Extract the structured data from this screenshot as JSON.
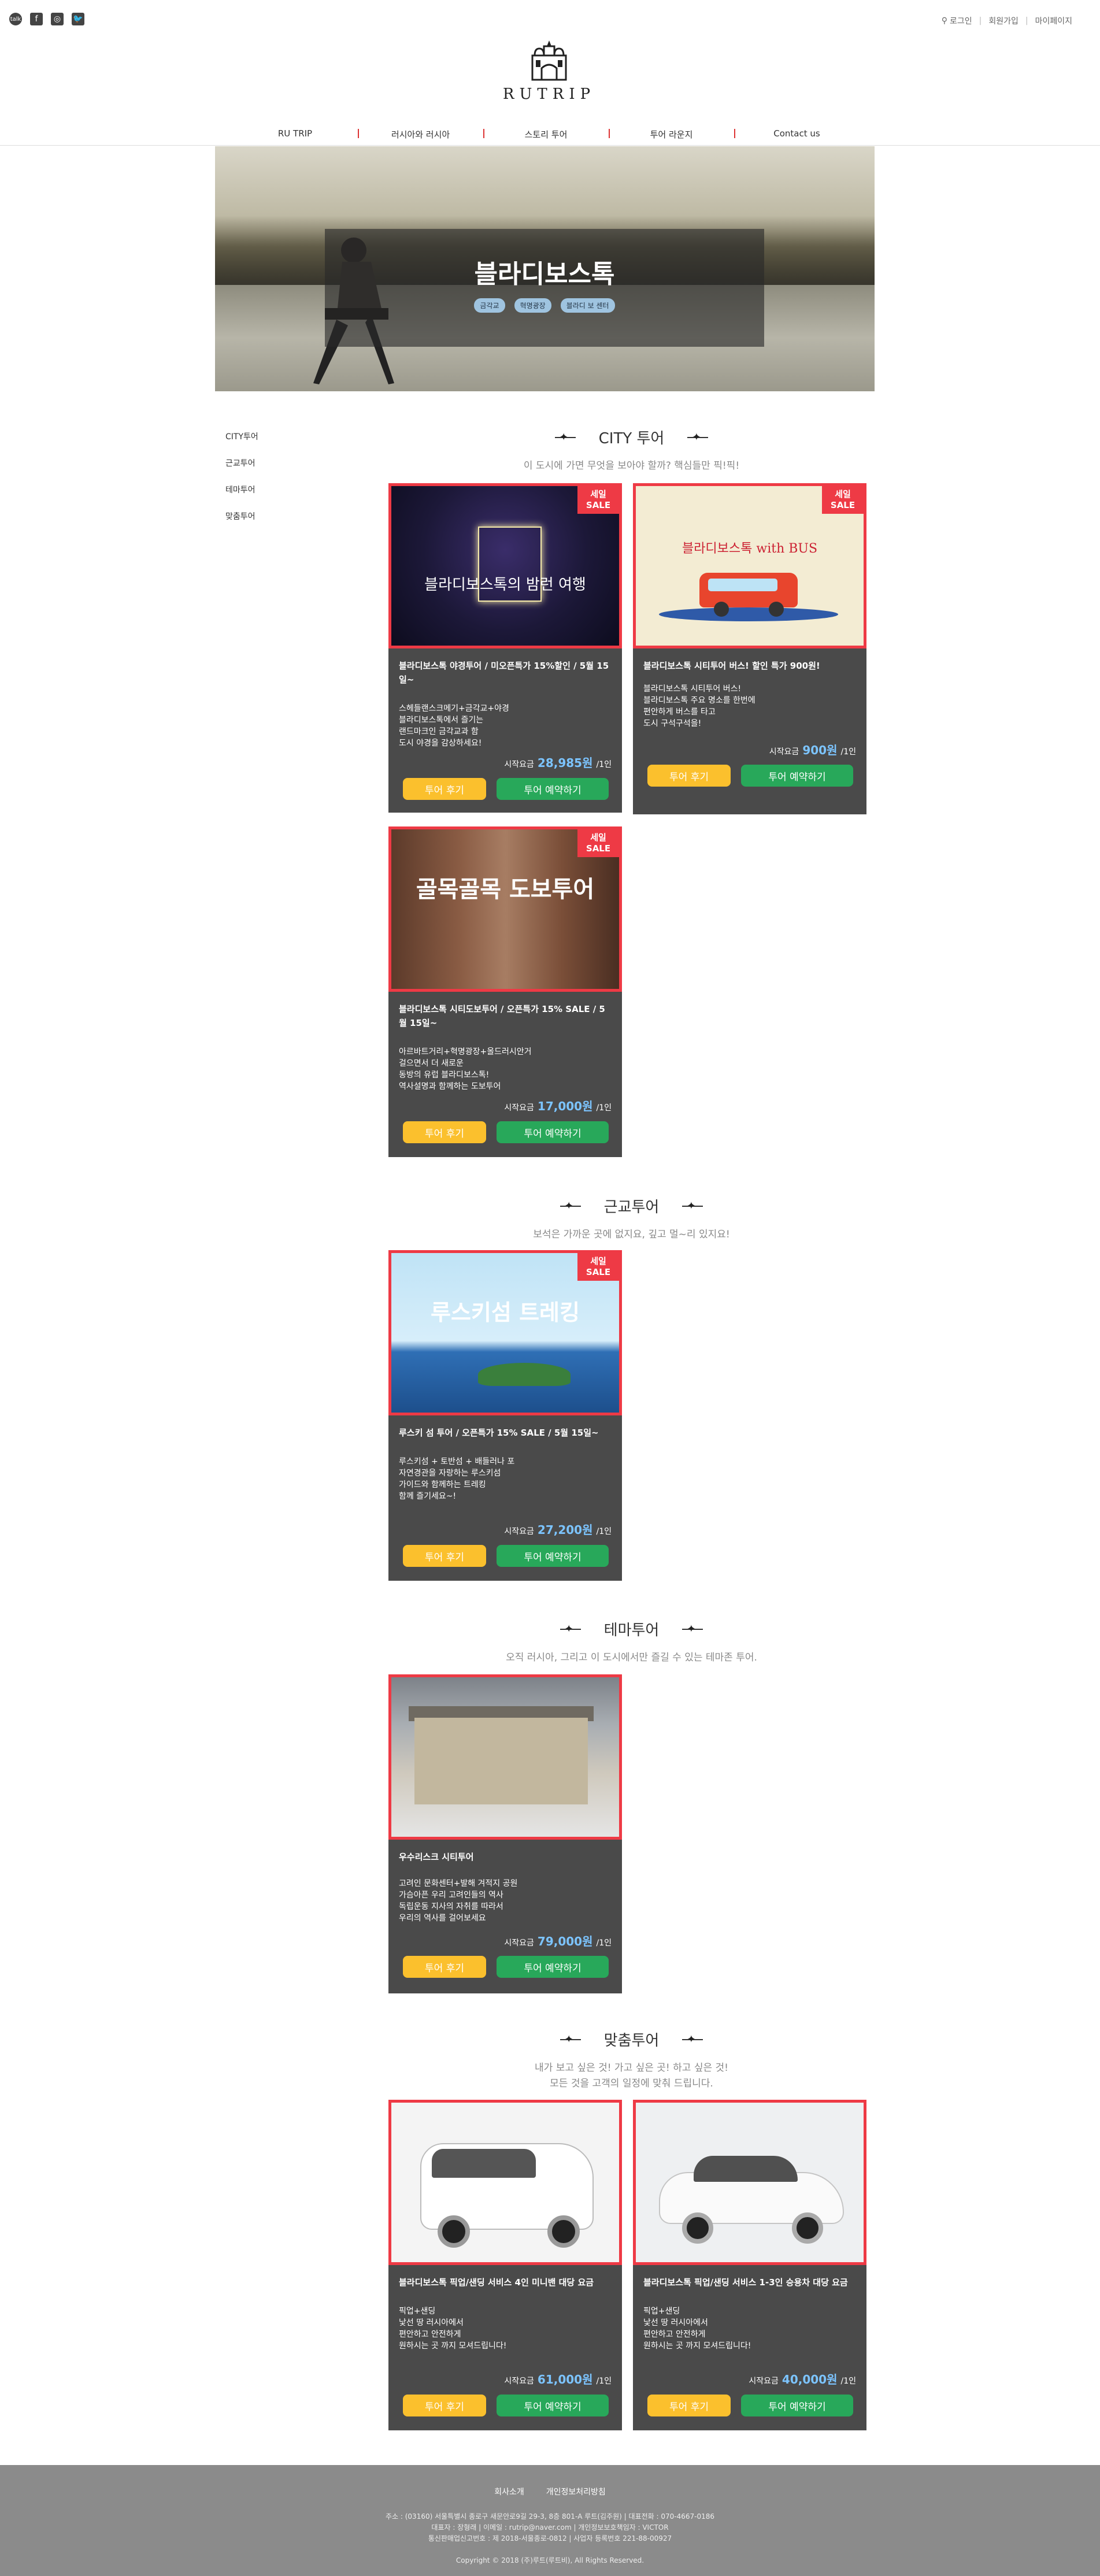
{
  "social": {
    "kakao": "talk",
    "facebook": "f",
    "instagram": "◎",
    "twitter": "🐦"
  },
  "utilnav": {
    "login": "로그인",
    "signup": "회원가입",
    "mypage": "마이페이지"
  },
  "logo": {
    "text": "RUTRIP"
  },
  "mainnav": [
    "RU TRIP",
    "러시아와 러시아",
    "스토리 투어",
    "투어 라운지",
    "Contact us"
  ],
  "hero": {
    "title": "블라디보스톡",
    "tags": [
      "금각교",
      "혁명광장",
      "블라디 보 센터"
    ]
  },
  "sidemenu": [
    "CITY투어",
    "근교투어",
    "테마투어",
    "맞춤투어"
  ],
  "sections": [
    {
      "title": "CITY 투어",
      "subtitle": "이 도시에 가면 무엇을 보아야 할까? 핵심들만 픽!픽!"
    },
    {
      "title": "근교투어",
      "subtitle": "보석은 가까운 곳에 없지요, 깊고 멀~리 있지요!"
    },
    {
      "title": "테마투어",
      "subtitle": "오직 러시아, 그리고 이 도시에서만 즐길 수 있는 테마존 투어."
    },
    {
      "title": "맞춤투어",
      "subtitle": "내가 보고 싶은 것! 가고 싶은 곳! 하고 싶은 것!",
      "subtitle2": "모든 것을 고객의 일정에 맞춰 드립니다."
    }
  ],
  "badge": {
    "line1": "세일",
    "line2": "SALE"
  },
  "price_label": "시작요금",
  "per_person": "/1인",
  "review_label": "투어 후기",
  "book_label": "투어 예약하기",
  "cards": [
    {
      "title": "블라디보스톡 야경투어 / 미오픈특가 15%할인 / 5월 15일~",
      "desc": [
        "스헤들랜스크메기+금각교+야경",
        "블라디보스톡에서 즐기는",
        "랜드마크인 금각교과 함",
        "도시 야경을 감상하세요!"
      ],
      "price": "28,985원",
      "art": "블라디보스톡의 밤런 여행"
    },
    {
      "title": "블라디보스톡 시티투어 버스! 할인 특가 900원!",
      "desc": [
        "블라디보스톡 시티투어 버스!",
        "블라디보스톡 주요 명소를 한번에",
        "편안하게 버스를 타고",
        "도시 구석구석을!"
      ],
      "price": "900원",
      "art": "블라디보스톡 with BUS"
    },
    {
      "title": "블라디보스톡 시티도보투어 / 오픈특가 15% SALE / 5월 15일~",
      "desc": [
        "아르바트거리+혁명광장+올드러시안거",
        "걸으면서 더 새로운",
        "동방의 유럽 블라디보스톡!",
        "역사설명과 함께하는 도보투어"
      ],
      "price": "17,000원",
      "art": "골목골목 도보투어"
    },
    {
      "title": "루스키 섬 투어 / 오픈특가 15% SALE / 5월 15일~",
      "desc": [
        "루스키섬 + 토반섬 + 배들러나 포",
        "자연경관을 자랑하는 루스키섬",
        "가이드와 함께하는 트레킹",
        "함께 즐기세요~!"
      ],
      "price": "27,200원",
      "art": "루스키섬 트레킹"
    },
    {
      "title": "우수리스크 시티투어",
      "desc": [
        "고려인 문화센터+발해 겨적지 공원",
        "가슴아픈 우리 고려인들의 역사",
        "독립운동 지사의 자취를 따라서",
        "우리의 역사를 걸어보세요"
      ],
      "price": "79,000원"
    },
    {
      "title": "블라디보스톡 픽업/샌딩 서비스 4인 미니밴 대당 요금",
      "desc": [
        "픽업+샌딩",
        "낯선 땅 러시아에서",
        "편안하고 안전하게",
        "원하시는 곳 까지 모셔드립니다!"
      ],
      "price": "61,000원"
    },
    {
      "title": "블라디보스톡 픽업/샌딩 서비스 1-3인 승용차 대당 요금",
      "desc": [
        "픽업+샌딩",
        "낯선 땅 러시아에서",
        "편안하고 안전하게",
        "원하시는 곳 까지 모셔드립니다!"
      ],
      "price": "40,000원"
    }
  ],
  "footer": {
    "links": [
      "회사소개",
      "개인정보처리방침"
    ],
    "info": [
      "주소 : (03160) 서울특별시 종로구 새문안로9길 29-3, 8층 801-A 루트(김주원) | 대표전화 : 070-4667-0186",
      "대표자 : 장형래 | 이메일 : rutrip@naver.com | 개인정보보호책임자 : VICTOR",
      "통신판매업신고번호 : 제 2018-서울종로-0812 | 사업자 등록번호 221-88-00927"
    ],
    "copyright": "Copyright © 2018 (주)루트(루트비), All Rights Reserved."
  }
}
